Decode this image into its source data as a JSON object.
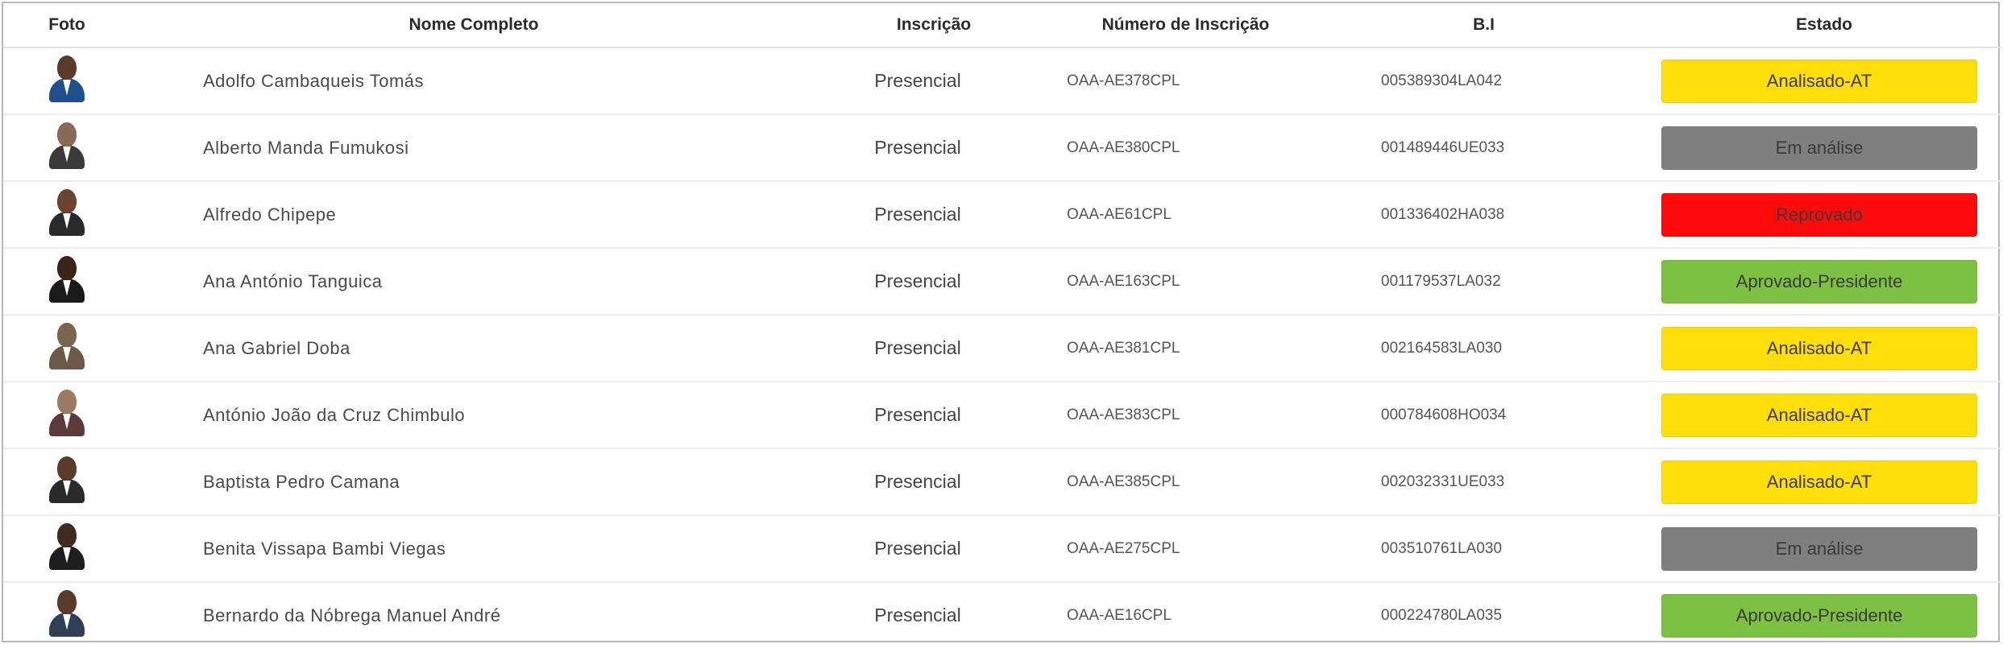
{
  "headers": {
    "foto": "Foto",
    "nome": "Nome Completo",
    "inscricao": "Inscrição",
    "numero": "Número de Inscrição",
    "bi": "B.I",
    "estado": "Estado"
  },
  "status_colors": {
    "Analisado-AT": "#ffde0a",
    "Em análise": "#7f7f7f",
    "Reprovado": "#ff0a0a",
    "Aprovado-Presidente": "#7dc142"
  },
  "rows": [
    {
      "nome": "Adolfo Cambaqueis Tomás",
      "inscricao": "Presencial",
      "numero": "OAA-AE378CPL",
      "bi": "005389304LA042",
      "estado": "Analisado-AT"
    },
    {
      "nome": "Alberto Manda Fumukosi",
      "inscricao": "Presencial",
      "numero": "OAA-AE380CPL",
      "bi": "001489446UE033",
      "estado": "Em análise"
    },
    {
      "nome": "Alfredo Chipepe",
      "inscricao": "Presencial",
      "numero": "OAA-AE61CPL",
      "bi": "001336402HA038",
      "estado": "Reprovado"
    },
    {
      "nome": "Ana António Tanguica",
      "inscricao": "Presencial",
      "numero": "OAA-AE163CPL",
      "bi": "001179537LA032",
      "estado": "Aprovado-Presidente"
    },
    {
      "nome": "Ana Gabriel Doba",
      "inscricao": "Presencial",
      "numero": "OAA-AE381CPL",
      "bi": "002164583LA030",
      "estado": "Analisado-AT"
    },
    {
      "nome": "António João da Cruz Chimbulo",
      "inscricao": "Presencial",
      "numero": "OAA-AE383CPL",
      "bi": "000784608HO034",
      "estado": "Analisado-AT"
    },
    {
      "nome": "Baptista Pedro Camana",
      "inscricao": "Presencial",
      "numero": "OAA-AE385CPL",
      "bi": "002032331UE033",
      "estado": "Analisado-AT"
    },
    {
      "nome": "Benita Vissapa Bambi Viegas",
      "inscricao": "Presencial",
      "numero": "OAA-AE275CPL",
      "bi": "003510761LA030",
      "estado": "Em análise"
    },
    {
      "nome": "Bernardo da Nóbrega Manuel André",
      "inscricao": "Presencial",
      "numero": "OAA-AE16CPL",
      "bi": "000224780LA035",
      "estado": "Aprovado-Presidente"
    }
  ]
}
